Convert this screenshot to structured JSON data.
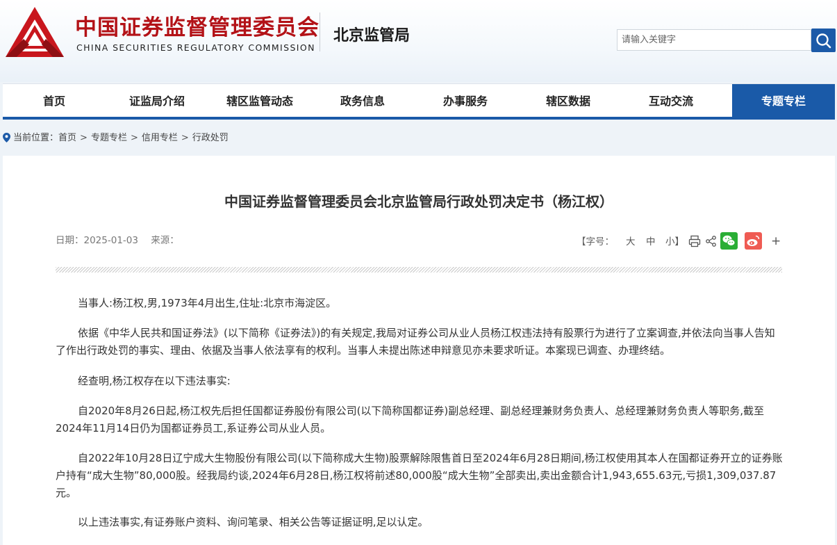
{
  "header": {
    "org_name": "中国证券监督管理委员会",
    "org_name_en": "CHINA SECURITIES REGULATORY COMMISSION",
    "bureau": "北京监管局",
    "search_placeholder": "请输入关键字",
    "brand_color": "#b31217",
    "accent_color": "#1a5aa8"
  },
  "nav": {
    "items": [
      {
        "label": "首页"
      },
      {
        "label": "证监局介绍"
      },
      {
        "label": "辖区监管动态"
      },
      {
        "label": "政务信息"
      },
      {
        "label": "办事服务"
      },
      {
        "label": "辖区数据"
      },
      {
        "label": "互动交流"
      },
      {
        "label": "专题专栏",
        "active": true
      }
    ]
  },
  "breadcrumb": {
    "prefix": "当前位置：",
    "items": [
      "首页",
      "专题专栏",
      "信用专栏",
      "行政处罚"
    ],
    "separator": ">"
  },
  "article": {
    "title": "中国证券监督管理委员会北京监管局行政处罚决定书（杨江权）",
    "date_label": "日期：2025-01-03",
    "source_label": "来源：",
    "font_size_label": "【字号：",
    "size_large": "大",
    "size_medium": "中",
    "size_small": "小】",
    "more": "+",
    "paragraphs": [
      "当事人:杨江权,男,1973年4月出生,住址:北京市海淀区。",
      "依据《中华人民共和国证券法》(以下简称《证券法》)的有关规定,我局对证券公司从业人员杨江权违法持有股票行为进行了立案调查,并依法向当事人告知了作出行政处罚的事实、理由、依据及当事人依法享有的权利。当事人未提出陈述申辩意见亦未要求听证。本案现已调查、办理终结。",
      "经查明,杨江权存在以下违法事实:",
      "自2020年8月26日起,杨江权先后担任国都证券股份有限公司(以下简称国都证券)副总经理、副总经理兼财务负责人、总经理兼财务负责人等职务,截至2024年11月14日仍为国都证券员工,系证券公司从业人员。",
      "自2022年10月28日辽宁成大生物股份有限公司(以下简称成大生物)股票解除限售首日至2024年6月28日期间,杨江权使用其本人在国都证券开立的证券账户持有“成大生物”80,000股。经我局约谈,2024年6月28日,杨江权将前述80,000股“成大生物”全部卖出,卖出金额合计1,943,655.63元,亏损1,309,037.87元。",
      "以上违法事实,有证券账户资料、询问笔录、相关公告等证据证明,足以认定。"
    ]
  }
}
